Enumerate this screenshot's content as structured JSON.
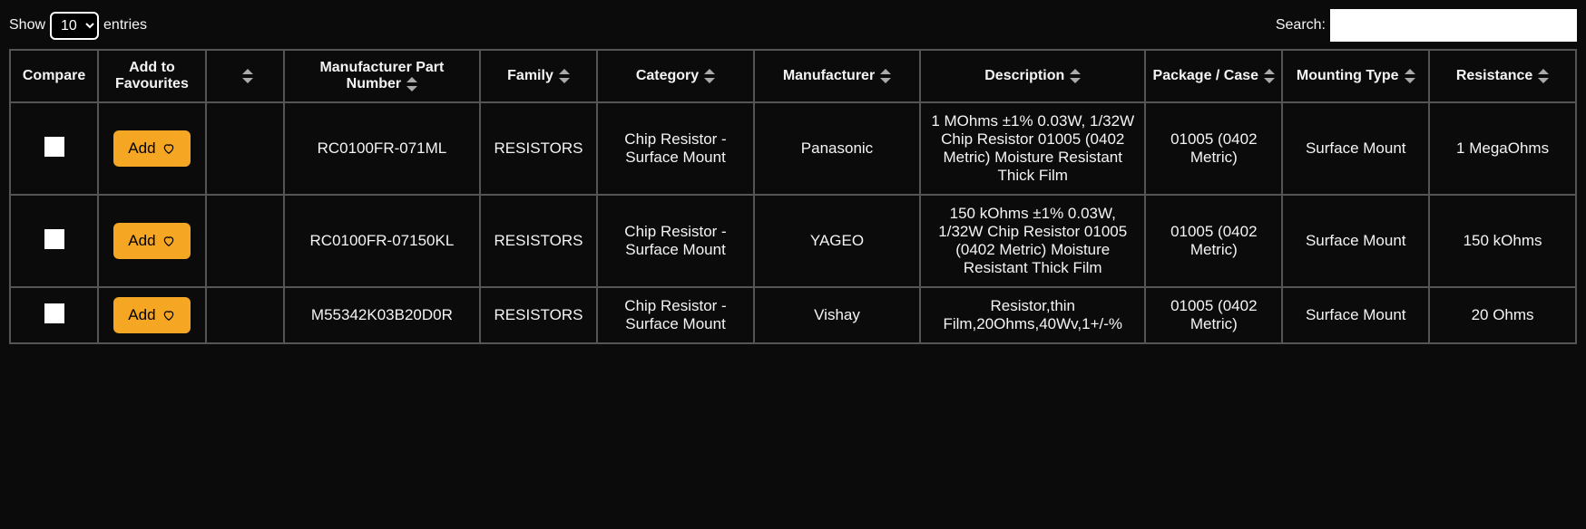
{
  "controls": {
    "show_label_prefix": "Show",
    "show_label_suffix": "entries",
    "show_value": "10",
    "search_label": "Search:",
    "search_value": ""
  },
  "columns": {
    "compare": "Compare",
    "favourites": "Add to Favourites",
    "blank": "",
    "part_number": "Manufacturer Part Number",
    "family": "Family",
    "category": "Category",
    "manufacturer": "Manufacturer",
    "description": "Description",
    "package": "Package / Case",
    "mounting": "Mounting Type",
    "resistance": "Resistance"
  },
  "buttons": {
    "add": "Add"
  },
  "rows": [
    {
      "part_number": "RC0100FR-071ML",
      "family": "RESISTORS",
      "category": "Chip Resistor - Surface Mount",
      "manufacturer": "Panasonic",
      "description": "1 MOhms ±1% 0.03W, 1/32W Chip Resistor 01005 (0402 Metric) Moisture Resistant Thick Film",
      "package": "01005 (0402 Metric)",
      "mounting": "Surface Mount",
      "resistance": "1 MegaOhms"
    },
    {
      "part_number": "RC0100FR-07150KL",
      "family": "RESISTORS",
      "category": "Chip Resistor - Surface Mount",
      "manufacturer": "YAGEO",
      "description": "150 kOhms ±1% 0.03W, 1/32W Chip Resistor 01005 (0402 Metric) Moisture Resistant Thick Film",
      "package": "01005 (0402 Metric)",
      "mounting": "Surface Mount",
      "resistance": "150 kOhms"
    },
    {
      "part_number": "M55342K03B20D0R",
      "family": "RESISTORS",
      "category": "Chip Resistor - Surface Mount",
      "manufacturer": "Vishay",
      "description": "Resistor,thin Film,20Ohms,40Wv,1+/-%",
      "package": "01005 (0402 Metric)",
      "mounting": "Surface Mount",
      "resistance": "20 Ohms"
    }
  ]
}
